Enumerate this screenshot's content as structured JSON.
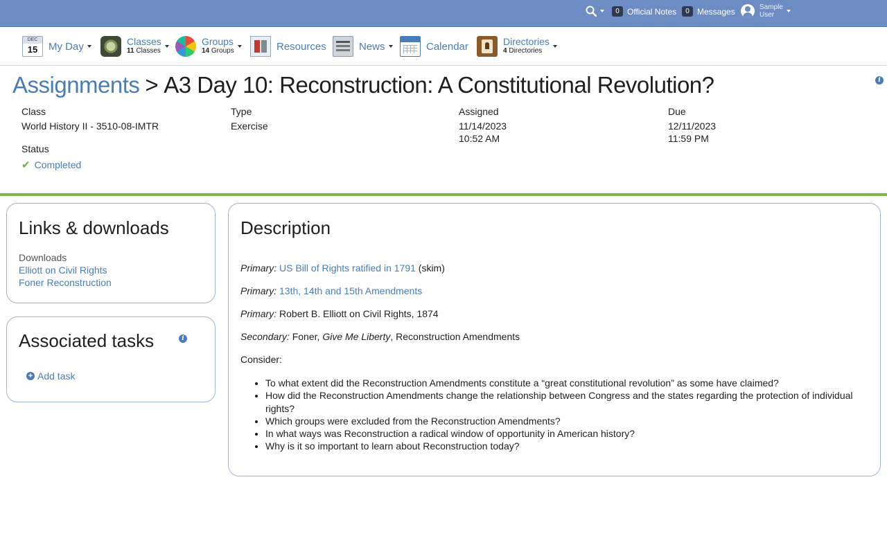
{
  "topbar": {
    "official_notes": {
      "count": "0",
      "label": "Official Notes"
    },
    "messages": {
      "count": "0",
      "label": "Messages"
    },
    "user": {
      "first": "Sample",
      "last": "User"
    }
  },
  "nav": {
    "myday": {
      "month": "DEC",
      "day": "15",
      "label": "My Day"
    },
    "classes": {
      "label": "Classes",
      "count": "11",
      "sub": "Classes"
    },
    "groups": {
      "label": "Groups",
      "count": "14",
      "sub": "Groups"
    },
    "resources": {
      "label": "Resources"
    },
    "news": {
      "label": "News"
    },
    "calendar": {
      "label": "Calendar"
    },
    "directories": {
      "label": "Directories",
      "count": "4",
      "sub": "Directories"
    }
  },
  "header": {
    "breadcrumb": "Assignments",
    "separator": ">",
    "title": "A3 Day 10: Reconstruction: A Constitutional Revolution?"
  },
  "meta": {
    "class_label": "Class",
    "class_value": "World History II - 3510-08-IMTR",
    "type_label": "Type",
    "type_value": "Exercise",
    "assigned_label": "Assigned",
    "assigned_date": "11/14/2023",
    "assigned_time": "10:52 AM",
    "due_label": "Due",
    "due_date": "12/11/2023",
    "due_time": "11:59 PM",
    "status_label": "Status",
    "status_value": "Completed"
  },
  "links_panel": {
    "title": "Links & downloads",
    "downloads_label": "Downloads",
    "items": [
      "Elliott on Civil Rights",
      "Foner Reconstruction"
    ]
  },
  "tasks_panel": {
    "title": "Associated tasks",
    "add_label": "Add task"
  },
  "description": {
    "title": "Description",
    "line1": {
      "prefix": "Primary:",
      "link": "US Bill of Rights ratified in 1791",
      "suffix": " (skim)"
    },
    "line2": {
      "prefix": "Primary:",
      "link": "13th, 14th and 15th Amendments"
    },
    "line3": {
      "prefix": "Primary:",
      "text": "Robert B. Elliott on Civil Rights, 1874"
    },
    "line4": {
      "prefix": "Secondary:",
      "text_a": "Foner, ",
      "italic": "Give Me Liberty",
      "text_b": ", Reconstruction Amendments"
    },
    "consider": "Consider:",
    "questions": [
      "To what extent did the Reconstruction Amendments constitute a “great constitutional revolution” as some have claimed?",
      "How did the Reconstruction Amendments change the relationship between Congress and the states regarding the protection of individual rights?",
      "Which groups were excluded from the Reconstruction Amendments?",
      "In what ways was Reconstruction a radical window of opportunity in American history?",
      "Why is it so important to learn about Reconstruction today?"
    ]
  },
  "colors": {
    "topbar": "#6d8cc4",
    "link": "#4a7db8",
    "divider": "#7ab648",
    "panel_border": "#9fb4d4",
    "check": "#6cb33f"
  }
}
